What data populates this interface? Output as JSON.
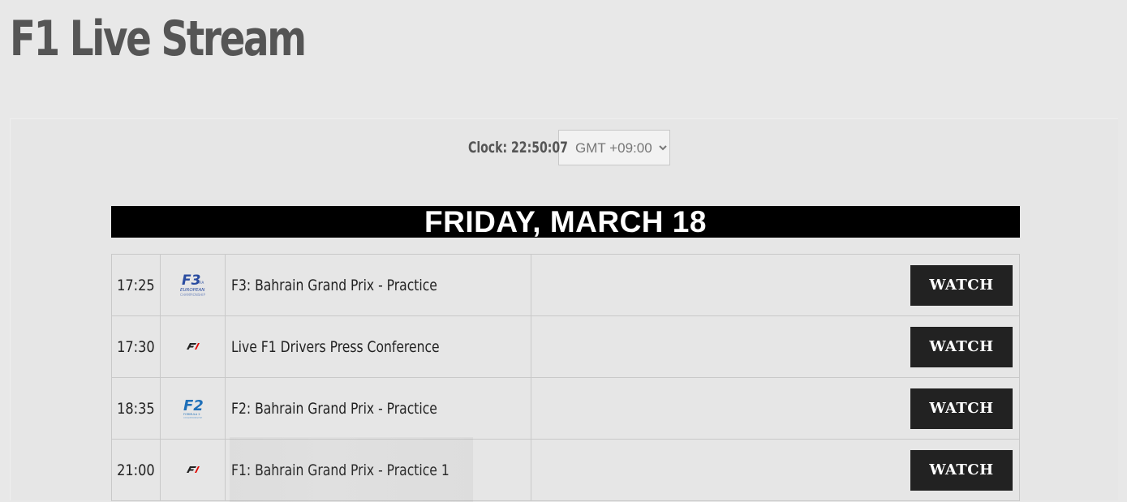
{
  "header": {
    "title": "F1 Live Stream"
  },
  "clock": {
    "label": "Clock: 22:50:07",
    "timezone_selected": "GMT +09:00"
  },
  "schedule": {
    "day_title": "FRIDAY, MARCH 18",
    "events": [
      {
        "time": "17:25",
        "series_icon": "f3-logo-icon",
        "title": "F3: Bahrain Grand Prix - Practice",
        "action_label": "WATCH"
      },
      {
        "time": "17:30",
        "series_icon": "f1-logo-icon",
        "title": "Live F1 Drivers Press Conference",
        "action_label": "WATCH"
      },
      {
        "time": "18:35",
        "series_icon": "f2-logo-icon",
        "title": "F2: Bahrain Grand Prix - Practice",
        "action_label": "WATCH"
      },
      {
        "time": "21:00",
        "series_icon": "f1-logo-icon",
        "title": "F1: Bahrain Grand Prix - Practice 1",
        "action_label": "WATCH"
      }
    ]
  },
  "colors": {
    "background": "#e8e8e8",
    "title_text": "#555555",
    "day_header_bg": "#000000",
    "button_bg": "#222222",
    "f2_blue": "#1e6fb8",
    "f3_blue": "#2a4ca0",
    "f1_red": "#e10600"
  }
}
